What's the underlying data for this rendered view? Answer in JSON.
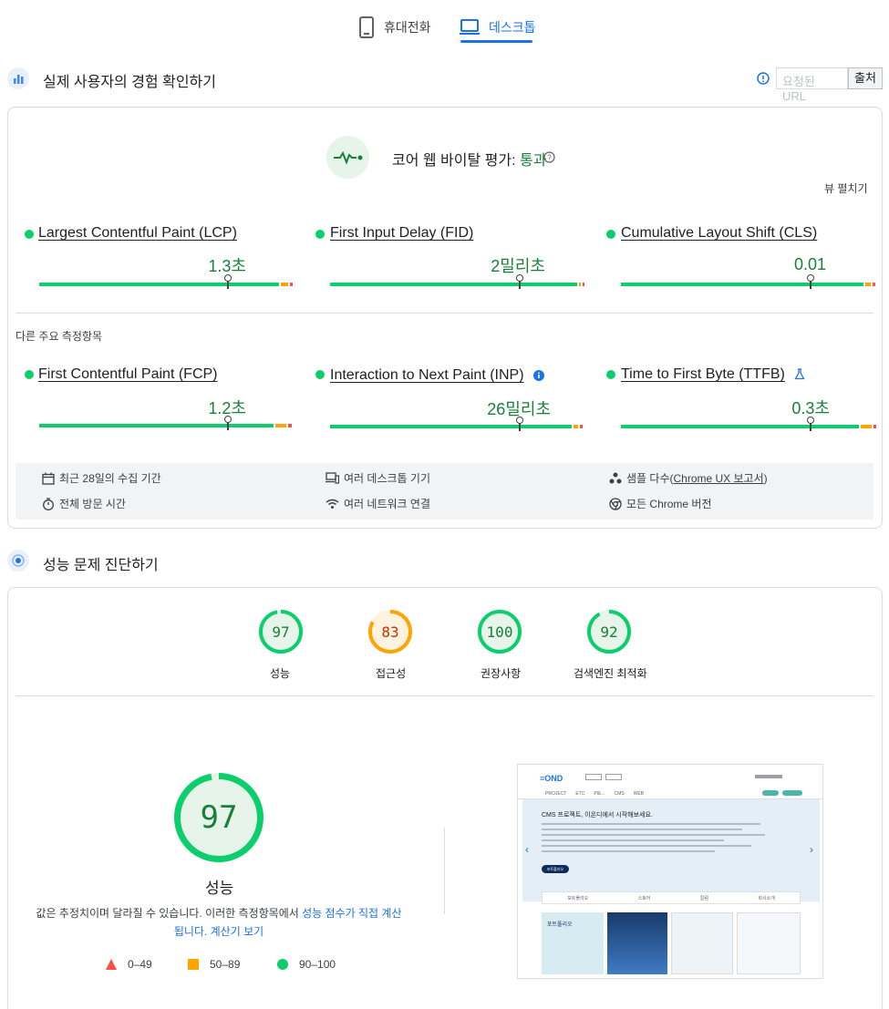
{
  "tabs": [
    {
      "label": "휴대전화",
      "icon": "smartphone-icon",
      "active": false
    },
    {
      "label": "데스크톱",
      "icon": "laptop-icon",
      "active": true
    }
  ],
  "field": {
    "title": "실제 사용자의 경험 확인하기",
    "url_placeholder": "요청된 URL",
    "url_button": "출처",
    "cwv_title": "코어 웹 바이탈 평가: ",
    "cwv_status": "통과",
    "expand_view": "뷰 펼치기",
    "core_metrics": [
      {
        "name": "Largest Contentful Paint (LCP)",
        "value": "1.3초"
      },
      {
        "name": "First Input Delay (FID)",
        "value": "2밀리초"
      },
      {
        "name": "Cumulative Layout Shift (CLS)",
        "value": "0.01"
      }
    ],
    "other_label": "다른 주요 측정항목",
    "other_metrics": [
      {
        "name": "First Contentful Paint (FCP)",
        "value": "1.2초"
      },
      {
        "name": "Interaction to Next Paint (INP)",
        "value": "26밀리초"
      },
      {
        "name": "Time to First Byte (TTFB)",
        "value": "0.3초"
      }
    ],
    "info": {
      "period": "최근 28일의 수집 기간",
      "devices": "여러 데스크톱 기기",
      "samples_prefix": "샘플 다수(",
      "samples_link": "Chrome UX 보고서",
      "samples_suffix": ")",
      "duration": "전체 방문 시간",
      "network": "여러 네트워크 연결",
      "chrome": "모든 Chrome 버전"
    }
  },
  "lab": {
    "title": "성능 문제 진단하기",
    "scores": [
      {
        "label": "성능",
        "score": 97
      },
      {
        "label": "접근성",
        "score": 83
      },
      {
        "label": "권장사항",
        "score": 100
      },
      {
        "label": "검색엔진 최적화",
        "score": 92
      }
    ],
    "big_score": 97,
    "big_label": "성능",
    "note_text": "값은 추정치이며 달라질 수 있습니다. 이러한 측정항목에서 ",
    "note_link1": "성능 점수가 직접 계산됩니다.",
    "note_link2": "계산기 보기",
    "legend": [
      {
        "range": "0–49",
        "shape": "triangle",
        "color": "#ff4e42"
      },
      {
        "range": "50–89",
        "shape": "square",
        "color": "#ffa400"
      },
      {
        "range": "90–100",
        "shape": "circle",
        "color": "#0cce6b"
      }
    ]
  },
  "screenshot": {
    "logo": "≡OND",
    "nav": [
      "PROJECT",
      "ETC",
      "PIE...",
      "CMS",
      "WEB"
    ],
    "headline": "CMS 프로젝트, 이온디에서 시작해보세요.",
    "button": "포트폴리오",
    "tabs": [
      "포트폴리오",
      "스토어",
      "칼럼",
      "회사소개"
    ],
    "panel_title": "포트폴리오"
  },
  "colors": {
    "pass": "#0cce6b",
    "average": "#ffa400",
    "fail": "#ff4e42",
    "accent": "#1a73e8"
  }
}
